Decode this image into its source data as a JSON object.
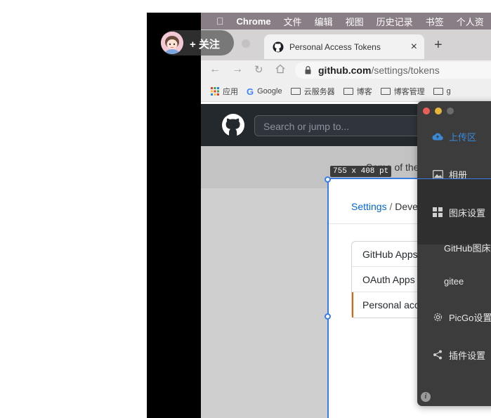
{
  "overlay": {
    "follow_label": "+ 关注"
  },
  "menubar": {
    "items": [
      "Chrome",
      "文件",
      "编辑",
      "视图",
      "历史记录",
      "书签",
      "个人资"
    ]
  },
  "browser": {
    "tab_title": "Personal Access Tokens",
    "tab_close": "×",
    "new_tab": "+",
    "url_prefix": "github.com",
    "url_path": "/settings/tokens",
    "bookmarks": [
      "应用",
      "Google",
      "云服务器",
      "博客",
      "博客管理",
      "g"
    ]
  },
  "github": {
    "search_placeholder": "Search or jump to...",
    "banner_text": "Some of the sco",
    "breadcrumb_settings": "Settings",
    "breadcrumb_sep": "/",
    "breadcrumb_dev": "Deve",
    "menu": [
      "GitHub Apps",
      "OAuth Apps",
      "Personal acc"
    ]
  },
  "selection": {
    "dimensions": "755 x 408  pt"
  },
  "picgo": {
    "items": [
      "上传区",
      "相册",
      "图床设置",
      "GitHub图床",
      "gitee",
      "PicGo设置",
      "插件设置"
    ],
    "accent": "#3a88d8",
    "info_icon": "i"
  }
}
